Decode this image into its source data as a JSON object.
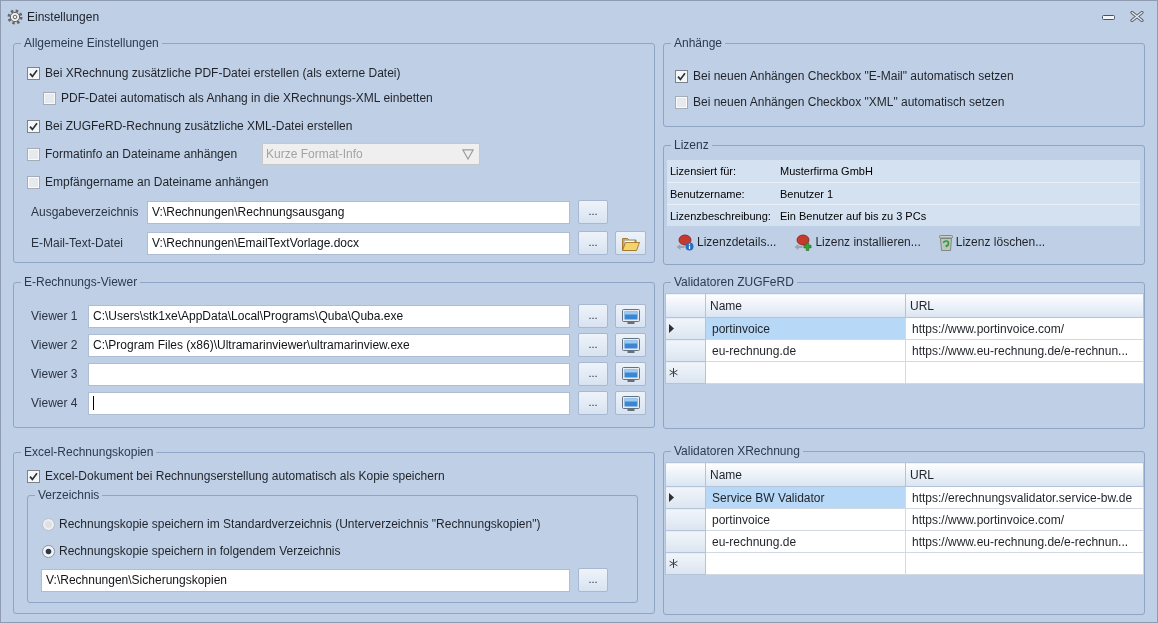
{
  "window": {
    "title": "Einstellungen"
  },
  "general": {
    "title": "Allgemeine Einstellungen",
    "options": [
      {
        "label": "Bei XRechnung zusätzliche PDF-Datei erstellen (als externe Datei)",
        "checked": true,
        "children": [
          {
            "label": "PDF-Datei automatisch als Anhang in die XRechnungs-XML einbetten",
            "checked": false
          }
        ]
      },
      {
        "label": "Bei ZUGFeRD-Rechnung zusätzliche XML-Datei erstellen",
        "checked": true
      },
      {
        "label": "Formatinfo an Dateiname anhängen",
        "checked": false,
        "dropdown": {
          "value": "Kurze Format-Info",
          "disabled": true
        }
      },
      {
        "label": "Empfängername an Dateiname anhängen",
        "checked": false
      }
    ],
    "paths": [
      {
        "label": "Ausgabeverzeichnis",
        "value": "V:\\Rechnungen\\Rechnungsausgang",
        "buttons": [
          {
            "kind": "browse",
            "label": "..."
          }
        ]
      },
      {
        "label": "E-Mail-Text-Datei",
        "value": "V:\\Rechnungen\\EmailTextVorlage.docx",
        "buttons": [
          {
            "kind": "browse",
            "label": "..."
          },
          {
            "kind": "open_folder"
          }
        ]
      }
    ]
  },
  "viewer": {
    "title": "E-Rechnungs-Viewer",
    "rows": [
      {
        "label": "Viewer 1",
        "value": "C:\\Users\\stk1xe\\AppData\\Local\\Programs\\Quba\\Quba.exe",
        "focused": false,
        "buttons": [
          {
            "kind": "browse",
            "label": "..."
          },
          {
            "kind": "preview"
          }
        ]
      },
      {
        "label": "Viewer 2",
        "value": "C:\\Program Files (x86)\\Ultramarinviewer\\ultramarinview.exe",
        "focused": false,
        "buttons": [
          {
            "kind": "browse",
            "label": "..."
          },
          {
            "kind": "preview"
          }
        ]
      },
      {
        "label": "Viewer 3",
        "focused": false,
        "buttons": [
          {
            "kind": "browse",
            "label": "..."
          },
          {
            "kind": "preview"
          }
        ]
      },
      {
        "label": "Viewer 4",
        "focused": true,
        "buttons": [
          {
            "kind": "browse",
            "label": "..."
          },
          {
            "kind": "preview"
          }
        ]
      }
    ]
  },
  "excel": {
    "title": "Excel-Rechnungskopien",
    "options": [
      {
        "label": "Excel-Dokument bei Rechnungserstellung automatisch als Kopie speichern",
        "checked": true
      }
    ],
    "directory": {
      "title": "Verzeichnis",
      "choices": [
        {
          "label": "Rechnungskopie speichern im Standardverzeichnis (Unterverzeichnis \"Rechnungskopien\")",
          "selected": false
        },
        {
          "label": "Rechnungskopie speichern in folgendem Verzeichnis",
          "selected": true
        }
      ],
      "path": {
        "value": "V:\\Rechnungen\\Sicherungskopien",
        "buttons": [
          {
            "kind": "browse",
            "label": "..."
          }
        ]
      }
    }
  },
  "attachments": {
    "title": "Anhänge",
    "options": [
      {
        "label": "Bei neuen Anhängen Checkbox \"E-Mail\" automatisch setzen",
        "checked": true
      },
      {
        "label": "Bei neuen Anhängen Checkbox \"XML\" automatisch setzen",
        "checked": false
      }
    ]
  },
  "license": {
    "title": "Lizenz",
    "rows": [
      {
        "label": "Lizensiert für:",
        "value": "Musterfirma GmbH"
      },
      {
        "label": "Benutzername:",
        "value": "Benutzer 1"
      },
      {
        "label": "Lizenzbeschreibung:",
        "value": "Ein Benutzer auf bis zu 3 PCs"
      }
    ],
    "actions": [
      {
        "kind": "details",
        "label": "Lizenzdetails..."
      },
      {
        "kind": "install",
        "label": "Lizenz installieren..."
      },
      {
        "kind": "delete",
        "label": "Lizenz löschen..."
      }
    ]
  },
  "validators": [
    {
      "title": "Validatoren ZUGFeRD",
      "columns": [
        "Name",
        "URL"
      ],
      "rows": [
        {
          "cells": [
            "portinvoice",
            "https://www.portinvoice.com/"
          ],
          "selected": true
        },
        {
          "cells": [
            "eu-rechnung.de",
            "https://www.eu-rechnung.de/e-rechnun..."
          ],
          "selected": false
        }
      ]
    },
    {
      "title": "Validatoren XRechnung",
      "columns": [
        "Name",
        "URL"
      ],
      "rows": [
        {
          "cells": [
            "Service BW Validator",
            "https://erechnungsvalidator.service-bw.de"
          ],
          "selected": true
        },
        {
          "cells": [
            "portinvoice",
            "https://www.portinvoice.com/"
          ],
          "selected": false
        },
        {
          "cells": [
            "eu-rechnung.de",
            "https://www.eu-rechnung.de/e-rechnun..."
          ],
          "selected": false
        }
      ]
    }
  ]
}
